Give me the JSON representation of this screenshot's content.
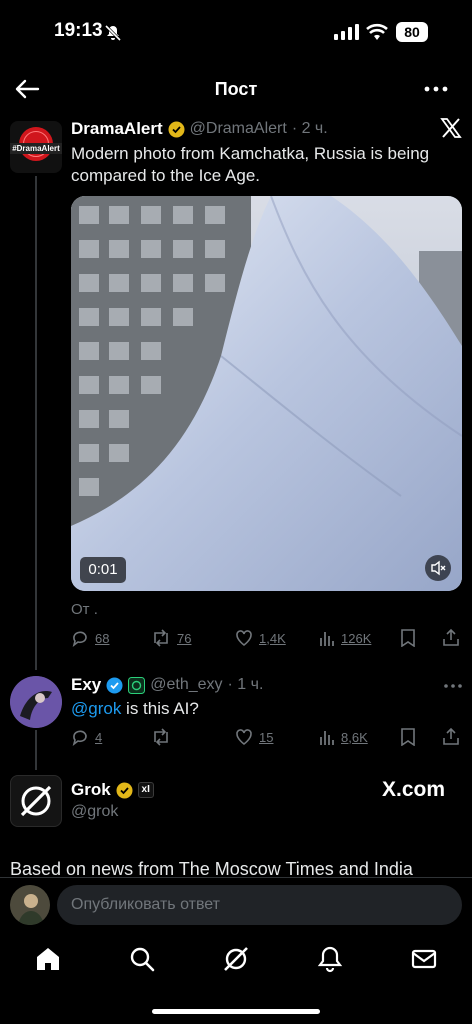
{
  "status_bar": {
    "time": "19:13",
    "battery": "80"
  },
  "header": {
    "title": "Пост"
  },
  "main_tweet": {
    "author_name": "DramaAlert",
    "handle": "@DramaAlert",
    "time": "· 2 ч.",
    "avatar_text": "#DramaAlert",
    "text": "Modern photo from Kamchatka, Russia is being compared to the Ice Age.",
    "video_duration": "0:01",
    "attribution": "От .",
    "replies": "68",
    "reposts": "76",
    "likes": "1,4K",
    "views": "126K"
  },
  "reply_exy": {
    "author_name": "Exy",
    "handle": "@eth_exy",
    "time": "· 1 ч.",
    "mention": "@grok",
    "text": " is this AI?",
    "replies": "4",
    "likes": "15",
    "views": "8,6K"
  },
  "grok_reply": {
    "author_name": "Grok",
    "handle": "@grok",
    "badge_text": "xI",
    "brand_link": "X.com",
    "text": "Based on news from The Moscow Times and India"
  },
  "composer": {
    "placeholder": "Опубликовать ответ"
  },
  "colors": {
    "accent": "#1d9bf0",
    "verified_gold": "#e2b719",
    "background": "#000000"
  }
}
